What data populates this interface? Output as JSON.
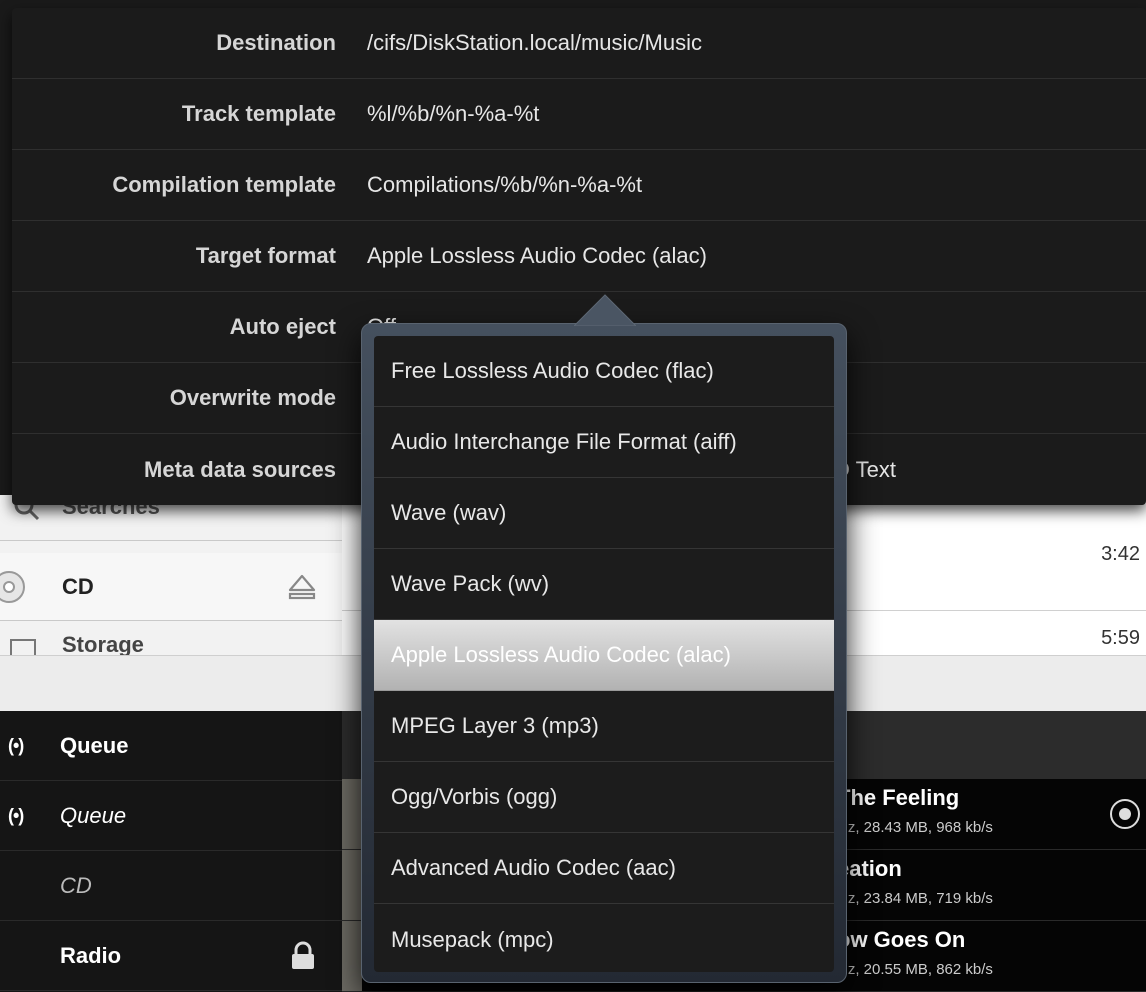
{
  "settings": {
    "rows": [
      {
        "label": "Destination",
        "value": "/cifs/DiskStation.local/music/Music"
      },
      {
        "label": "Track template",
        "value": "%l/%b/%n-%a-%t"
      },
      {
        "label": "Compilation template",
        "value": "Compilations/%b/%n-%a-%t"
      },
      {
        "label": "Target format",
        "value": "Apple Lossless Audio Codec (alac)"
      },
      {
        "label": "Auto eject",
        "value": "Off"
      },
      {
        "label": "Overwrite mode",
        "value": ""
      },
      {
        "label": "Meta data sources",
        "value": "D Text"
      }
    ]
  },
  "format_menu": {
    "items": [
      "Free Lossless Audio Codec (flac)",
      "Audio Interchange File Format (aiff)",
      "Wave (wav)",
      "Wave Pack (wv)",
      "Apple Lossless Audio Codec (alac)",
      "MPEG Layer 3 (mp3)",
      "Ogg/Vorbis (ogg)",
      "Advanced Audio Codec (aac)",
      "Musepack (mpc)"
    ],
    "selected": "Apple Lossless Audio Codec (alac)"
  },
  "sidebar": {
    "searches_label": "Searches",
    "cd_label": "CD",
    "storage_label": "Storage"
  },
  "durations": [
    "3:42",
    "5:59"
  ],
  "queue_panel": {
    "items": [
      {
        "label": "Queue",
        "style": "bold"
      },
      {
        "label": "Queue",
        "style": "italic"
      },
      {
        "label": "CD",
        "style": "dim"
      },
      {
        "label": "Radio",
        "style": "bold"
      }
    ]
  },
  "tracks": [
    {
      "title": "The Feeling",
      "sub": "Hz, 28.43 MB, 968 kb/s"
    },
    {
      "title": "eation",
      "sub": "Hz, 23.84 MB, 719 kb/s"
    },
    {
      "title": "ow Goes On",
      "sub": "Hz, 20.55 MB, 862 kb/s"
    }
  ],
  "colors": {
    "selected_gradient_top": "#e2e2e2",
    "selected_gradient_bottom": "#b2b2b2",
    "panel_bg": "#1b1b1b"
  }
}
